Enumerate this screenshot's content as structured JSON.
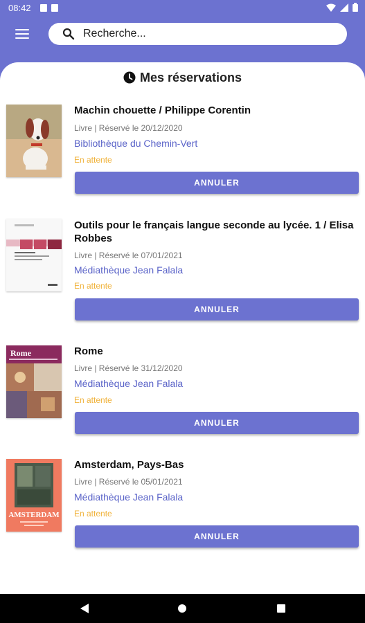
{
  "status_bar": {
    "time": "08:42"
  },
  "search": {
    "placeholder": "Recherche..."
  },
  "page": {
    "title": "Mes réservations"
  },
  "reservations": [
    {
      "title": "Machin chouette / Philippe Corentin",
      "meta": "Livre | Réservé le 20/12/2020",
      "library": "Bibliothèque du Chemin-Vert",
      "status": "En attente",
      "action": "ANNULER"
    },
    {
      "title": "Outils pour le français langue seconde au lycée. 1 / Elisa Robbes",
      "meta": "Livre | Réservé le 07/01/2021",
      "library": "Médiathèque Jean Falala",
      "status": "En attente",
      "action": "ANNULER"
    },
    {
      "title": "Rome",
      "meta": "Livre | Réservé le 31/12/2020",
      "library": "Médiathèque Jean Falala",
      "status": "En attente",
      "action": "ANNULER",
      "cover_text": "Rome"
    },
    {
      "title": "Amsterdam, Pays-Bas",
      "meta": "Livre | Réservé le 05/01/2021",
      "library": "Médiathèque Jean Falala",
      "status": "En attente",
      "action": "ANNULER",
      "cover_text": "AMSTERDAM"
    }
  ],
  "colors": {
    "primary": "#6c72d0",
    "library_link": "#5a63c8",
    "status_pending": "#f0b23a"
  }
}
